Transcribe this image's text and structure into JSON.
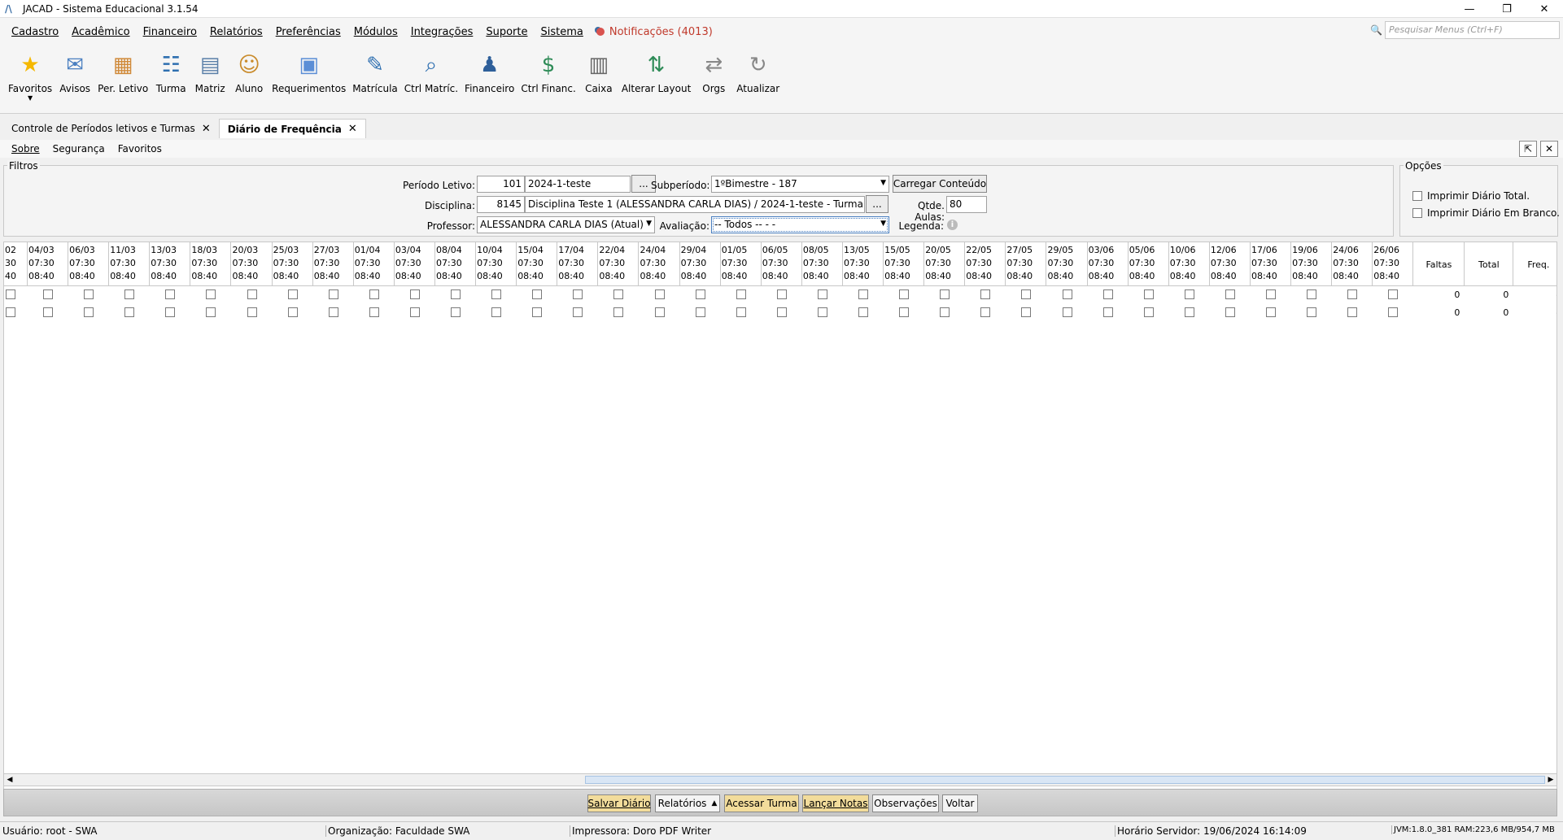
{
  "window": {
    "title": "JACAD - Sistema Educacional 3.1.54"
  },
  "menu": {
    "items": [
      "Cadastro",
      "Acadêmico",
      "Financeiro",
      "Relatórios",
      "Preferências",
      "Módulos",
      "Integrações",
      "Suporte",
      "Sistema"
    ],
    "notifications": "Notificações (4013)",
    "search_placeholder": "Pesquisar Menus (Ctrl+F)"
  },
  "toolbar": {
    "items": [
      {
        "label": "Favoritos",
        "icon": "star-icon"
      },
      {
        "label": "Avisos",
        "icon": "envelope-icon"
      },
      {
        "label": "Per. Letivo",
        "icon": "calendar-icon"
      },
      {
        "label": "Turma",
        "icon": "group-icon"
      },
      {
        "label": "Matriz",
        "icon": "matrix-icon"
      },
      {
        "label": "Aluno",
        "icon": "student-icon"
      },
      {
        "label": "Requerimentos",
        "icon": "document-check-icon"
      },
      {
        "label": "Matrícula",
        "icon": "pencil-document-icon"
      },
      {
        "label": "Ctrl Matríc.",
        "icon": "magnifier-document-icon"
      },
      {
        "label": "Financeiro",
        "icon": "person-money-icon"
      },
      {
        "label": "Ctrl Financ.",
        "icon": "money-hand-icon"
      },
      {
        "label": "Caixa",
        "icon": "cash-register-icon"
      },
      {
        "label": "Alterar Layout",
        "icon": "swap-icon"
      },
      {
        "label": "Orgs",
        "icon": "arrows-icon"
      },
      {
        "label": "Atualizar",
        "icon": "refresh-icon"
      }
    ]
  },
  "tabs": [
    {
      "label": "Controle de Períodos letivos e Turmas"
    },
    {
      "label": "Diário de Frequência"
    }
  ],
  "submenu": [
    "Sobre",
    "Segurança",
    "Favoritos"
  ],
  "filters": {
    "legend": "Filtros",
    "periodo_label": "Período Letivo:",
    "periodo_code": "101",
    "periodo_name": "2024-1-teste",
    "dots": "...",
    "subperiodo_label": "Subperíodo:",
    "subperiodo_value": "1ºBimestre - 187",
    "carregar": "Carregar Conteúdo",
    "disciplina_label": "Disciplina:",
    "disciplina_code": "8145",
    "disciplina_name": "Disciplina Teste 1 (ALESSANDRA CARLA DIAS) / 2024-1-teste - Turma Teste",
    "qtde_label": "Qtde. Aulas:",
    "qtde_value": "80",
    "professor_label": "Professor:",
    "professor_value": "ALESSANDRA CARLA DIAS (Atual)",
    "avaliacao_label": "Avaliação:",
    "avaliacao_value": "-- Todos -- -  -",
    "legenda_label": "Legenda:"
  },
  "options": {
    "legend": "Opções",
    "total": "Imprimir Diário Total.",
    "branco": "Imprimir Diário Em Branco."
  },
  "grid": {
    "first_col": {
      "date": "02",
      "start": "30",
      "end": "40"
    },
    "dates": [
      "04/03",
      "06/03",
      "11/03",
      "13/03",
      "18/03",
      "20/03",
      "25/03",
      "27/03",
      "01/04",
      "03/04",
      "08/04",
      "10/04",
      "15/04",
      "17/04",
      "22/04",
      "24/04",
      "29/04",
      "01/05",
      "06/05",
      "08/05",
      "13/05",
      "15/05",
      "20/05",
      "22/05",
      "27/05",
      "29/05",
      "03/06",
      "05/06",
      "10/06",
      "12/06",
      "17/06",
      "19/06",
      "24/06",
      "26/06"
    ],
    "start_time": "07:30",
    "end_time": "08:40",
    "headers": {
      "faltas": "Faltas",
      "total": "Total",
      "freq": "Freq."
    },
    "rows": [
      {
        "faltas": "0",
        "total": "0",
        "freq": "-"
      },
      {
        "faltas": "0",
        "total": "0",
        "freq": "-"
      }
    ]
  },
  "actions": {
    "salvar": "Salvar Diário",
    "relatorios": "Relatórios",
    "acessar": "Acessar Turma",
    "lancar": "Lançar Notas",
    "observacoes": "Observações",
    "voltar": "Voltar"
  },
  "status": {
    "usuario": "Usuário: root - SWA",
    "organizacao": "Organização: Faculdade SWA",
    "impressora": "Impressora: Doro PDF Writer",
    "horario": "Horário Servidor: 19/06/2024 16:14:09",
    "jvm": "JVM:1.8.0_381  RAM:223,6 MB/954,7 MB"
  }
}
